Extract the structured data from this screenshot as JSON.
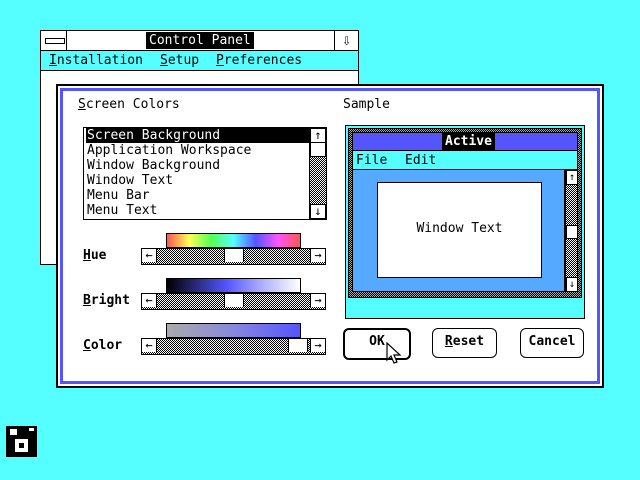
{
  "control_panel": {
    "title": "Control Panel",
    "menu": {
      "installation": {
        "first": "I",
        "rest": "nstallation"
      },
      "setup": {
        "first": "S",
        "rest": "etup"
      },
      "preferences": {
        "first": "P",
        "rest": "references"
      }
    }
  },
  "dialog": {
    "list_label": {
      "first": "S",
      "rest": "creen Colors"
    },
    "items": [
      "Screen Background",
      "Application Workspace",
      "Window Background",
      "Window Text",
      "Menu Bar",
      "Menu Text"
    ],
    "selected_index": 0,
    "hue_label": {
      "first": "H",
      "rest": "ue"
    },
    "bright_label": {
      "first": "B",
      "rest": "right"
    },
    "color_label": {
      "first": "C",
      "rest": "olor"
    },
    "sample_label": "Sample",
    "sample": {
      "title": "Active",
      "menu_file": "File",
      "menu_edit": "Edit",
      "window_text": "Window Text"
    },
    "buttons": {
      "ok": "OK",
      "reset": {
        "first": "R",
        "rest": "eset"
      },
      "cancel": "Cancel"
    }
  },
  "colors": {
    "desktop": "#55ffff",
    "active_title": "#5555ff",
    "workspace": "#55aaff",
    "menu_bar": "#55ffff"
  },
  "icons": [
    "system-menu-icon",
    "minimize-arrow-icon",
    "scroll-up-icon",
    "scroll-down-icon",
    "scroll-left-icon",
    "scroll-right-icon",
    "mouse-pointer-icon",
    "floppy-disk-icon"
  ]
}
